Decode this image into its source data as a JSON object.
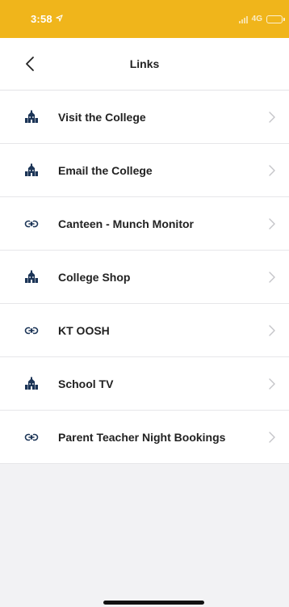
{
  "status": {
    "time": "3:58",
    "network": "4G",
    "location_icon": "location-arrow-icon",
    "battery_icon": "battery-icon"
  },
  "header": {
    "title": "Links",
    "back_icon": "chevron-left-icon"
  },
  "links": [
    {
      "label": "Visit the College",
      "icon": "college-building-icon"
    },
    {
      "label": "Email the College",
      "icon": "college-building-icon"
    },
    {
      "label": "Canteen - Munch Monitor",
      "icon": "link-icon"
    },
    {
      "label": "College Shop",
      "icon": "college-building-icon"
    },
    {
      "label": "KT OOSH",
      "icon": "link-icon"
    },
    {
      "label": "School TV",
      "icon": "college-building-icon"
    },
    {
      "label": "Parent Teacher Night Bookings",
      "icon": "link-icon"
    }
  ],
  "colors": {
    "status_bar": "#f0b51b",
    "icon": "#1c3557",
    "chevron": "#c4c4c8",
    "background": "#f2f2f4"
  }
}
